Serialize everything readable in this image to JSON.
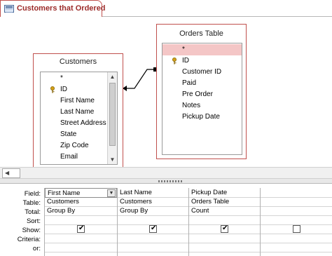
{
  "tab": {
    "title": "Customers that Ordered",
    "icon": "query-icon"
  },
  "customers_table": {
    "title": "Customers",
    "fields": [
      {
        "name": "*",
        "key": false
      },
      {
        "name": "ID",
        "key": true
      },
      {
        "name": "First Name",
        "key": false
      },
      {
        "name": "Last Name",
        "key": false
      },
      {
        "name": "Street Address",
        "key": false
      },
      {
        "name": "State",
        "key": false
      },
      {
        "name": "Zip Code",
        "key": false
      },
      {
        "name": "Email",
        "key": false
      }
    ]
  },
  "orders_table": {
    "title": "Orders Table",
    "fields": [
      {
        "name": "*",
        "key": false,
        "selected": true
      },
      {
        "name": "ID",
        "key": true
      },
      {
        "name": "Customer ID",
        "key": false
      },
      {
        "name": "Paid",
        "key": false
      },
      {
        "name": "Pre Order",
        "key": false
      },
      {
        "name": "Notes",
        "key": false
      },
      {
        "name": "Pickup Date",
        "key": false
      }
    ]
  },
  "relationship": {
    "from": "orders_table.Customer ID",
    "to": "customers_table.ID",
    "type": "one-to-many"
  },
  "grid": {
    "row_labels": [
      "Field:",
      "Table:",
      "Total:",
      "Sort:",
      "Show:",
      "Criteria:",
      "or:"
    ],
    "columns": [
      {
        "field": "First Name",
        "table": "Customers",
        "total": "Group By",
        "sort": "",
        "show": true,
        "criteria": "",
        "or": ""
      },
      {
        "field": "Last Name",
        "table": "Customers",
        "total": "Group By",
        "sort": "",
        "show": true,
        "criteria": "",
        "or": ""
      },
      {
        "field": "Pickup Date",
        "table": "Orders Table",
        "total": "Count",
        "sort": "",
        "show": true,
        "criteria": "",
        "or": ""
      },
      {
        "field": "",
        "table": "",
        "total": "",
        "sort": "",
        "show": false,
        "criteria": "",
        "or": ""
      }
    ]
  },
  "colors": {
    "table_border": "#c0504d",
    "selected_field": "#f4c6c6",
    "tab_text": "#9c2c2a"
  }
}
